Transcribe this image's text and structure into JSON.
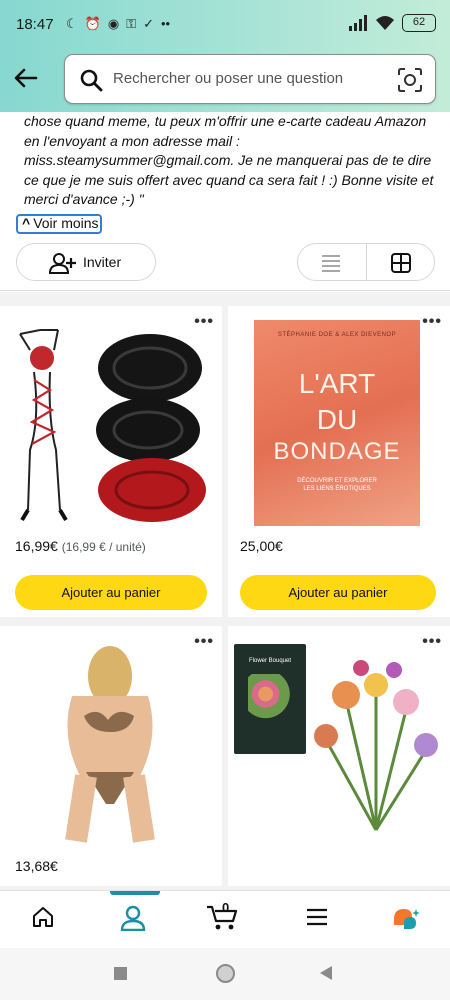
{
  "status_bar": {
    "time": "18:47",
    "battery": "62"
  },
  "search": {
    "placeholder": "Rechercher ou poser une question"
  },
  "profile": {
    "description_lines": [
      "chose quand meme, tu peux m'offrir une e-carte cadeau Amazon",
      "en l'envoyant a mon adresse mail :",
      "miss.steamysummer@gmail.com. Je ne manquerai pas de te dire",
      "ce que je me suis offert avec quand ca sera fait ! :) Bonne visite et",
      "merci d'avance ;-) \""
    ],
    "voir_moins": "Voir moins",
    "invite_label": "Inviter"
  },
  "products": [
    {
      "price": "16,99€",
      "unit_price": "(16,99 € / unité)",
      "button": "Ajouter au panier"
    },
    {
      "price": "25,00€",
      "unit_price": "",
      "button": "Ajouter au panier"
    },
    {
      "price": "13,68€",
      "unit_price": "",
      "button": ""
    },
    {
      "price": "",
      "unit_price": "",
      "button": ""
    }
  ],
  "book": {
    "authors": "STÉPHANIE DOE & ALEX DIEVENOP",
    "title_line1": "L'ART",
    "title_line2": "DU",
    "title_line3": "BONDAGE",
    "subtitle_line1": "DÉCOUVRIR ET EXPLORER",
    "subtitle_line2": "LES LIENS ÉROTIQUES"
  },
  "lego": {
    "box_title": "Flower Bouquet"
  },
  "bottom_nav": {
    "cart_count": "0"
  },
  "colors": {
    "accent": "#1a8fa6",
    "button_yellow": "#ffd814",
    "header_gradient_start": "#86d8d0",
    "header_gradient_end": "#c3ecd8"
  }
}
